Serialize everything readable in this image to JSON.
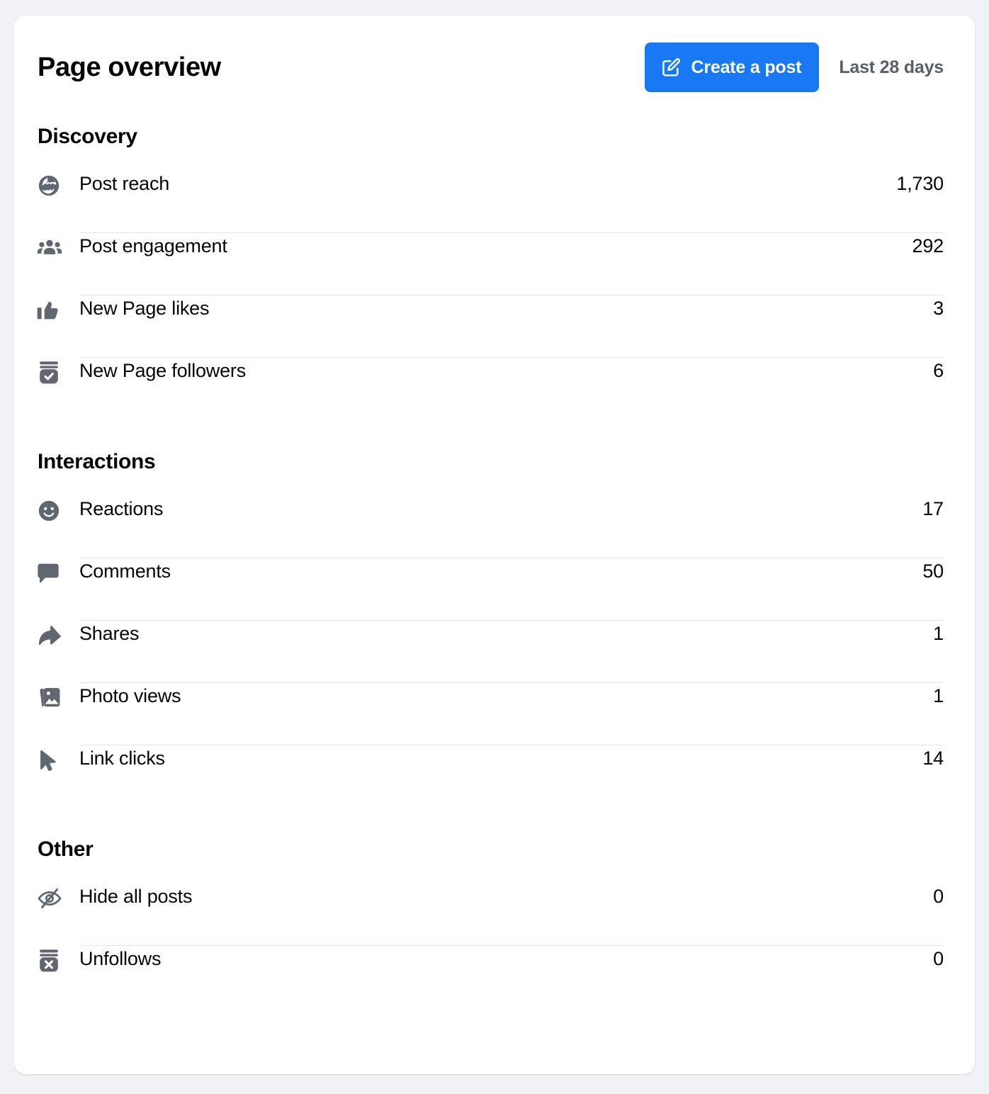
{
  "header": {
    "title": "Page overview",
    "create_post_label": "Create a post",
    "create_post_icon": "compose-icon",
    "date_range_label": "Last 28 days"
  },
  "colors": {
    "accent_blue": "#1877F2",
    "page_background": "#F0F2F5",
    "card_background": "#FFFFFF",
    "text_primary": "#050505",
    "text_secondary": "#5A5F66",
    "icon_gray": "#606770",
    "divider": "#E4E6E9"
  },
  "sections": [
    {
      "title": "Discovery",
      "rows": [
        {
          "icon": "globe-icon",
          "label": "Post reach",
          "value": "1,730"
        },
        {
          "icon": "people-group-icon",
          "label": "Post engagement",
          "value": "292"
        },
        {
          "icon": "thumbs-up-icon",
          "label": "New Page likes",
          "value": "3"
        },
        {
          "icon": "follower-check-icon",
          "label": "New Page followers",
          "value": "6"
        }
      ]
    },
    {
      "title": "Interactions",
      "rows": [
        {
          "icon": "smiley-face-icon",
          "label": "Reactions",
          "value": "17"
        },
        {
          "icon": "comment-icon",
          "label": "Comments",
          "value": "50"
        },
        {
          "icon": "share-arrow-icon",
          "label": "Shares",
          "value": "1"
        },
        {
          "icon": "photos-icon",
          "label": "Photo views",
          "value": "1"
        },
        {
          "icon": "cursor-icon",
          "label": "Link clicks",
          "value": "14"
        }
      ]
    },
    {
      "title": "Other",
      "rows": [
        {
          "icon": "eye-slash-icon",
          "label": "Hide all posts",
          "value": "0"
        },
        {
          "icon": "unfollow-x-icon",
          "label": "Unfollows",
          "value": "0"
        }
      ]
    }
  ]
}
